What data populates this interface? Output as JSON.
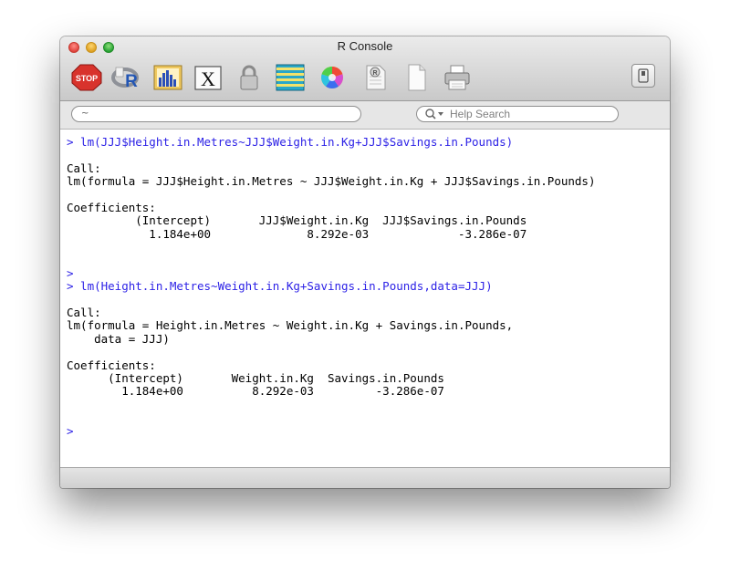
{
  "window": {
    "title": "R Console"
  },
  "toolbar": {
    "buttons": [
      {
        "name": "stop-button",
        "icon": "stop-sign-icon",
        "text": "STOP"
      },
      {
        "name": "source-script-button",
        "icon": "r-logo-icon"
      },
      {
        "name": "quartz-button",
        "icon": "bar-chart-icon"
      },
      {
        "name": "x11-button",
        "icon": "x-window-icon",
        "text": "X"
      },
      {
        "name": "authentication-button",
        "icon": "padlock-icon"
      },
      {
        "name": "show-history-button",
        "icon": "striped-list-icon"
      },
      {
        "name": "set-colors-button",
        "icon": "color-wheel-icon"
      },
      {
        "name": "open-document-button",
        "icon": "document-search-icon"
      },
      {
        "name": "new-document-button",
        "icon": "blank-document-icon"
      },
      {
        "name": "print-button",
        "icon": "printer-icon"
      }
    ],
    "toggle_icon": "toolbar-toggle-icon"
  },
  "search": {
    "working_dir": "~",
    "help_placeholder": "Help Search"
  },
  "console": {
    "lines": [
      {
        "kind": "cmd",
        "text": "> lm(JJJ$Height.in.Metres~JJJ$Weight.in.Kg+JJJ$Savings.in.Pounds)"
      },
      {
        "kind": "out",
        "text": ""
      },
      {
        "kind": "out",
        "text": "Call:"
      },
      {
        "kind": "out",
        "text": "lm(formula = JJJ$Height.in.Metres ~ JJJ$Weight.in.Kg + JJJ$Savings.in.Pounds)"
      },
      {
        "kind": "out",
        "text": ""
      },
      {
        "kind": "out",
        "text": "Coefficients:"
      },
      {
        "kind": "out",
        "text": "          (Intercept)       JJJ$Weight.in.Kg  JJJ$Savings.in.Pounds"
      },
      {
        "kind": "out",
        "text": "            1.184e+00              8.292e-03             -3.286e-07"
      },
      {
        "kind": "out",
        "text": ""
      },
      {
        "kind": "out",
        "text": ""
      },
      {
        "kind": "cmd",
        "text": ">"
      },
      {
        "kind": "cmd",
        "text": "> lm(Height.in.Metres~Weight.in.Kg+Savings.in.Pounds,data=JJJ)"
      },
      {
        "kind": "out",
        "text": ""
      },
      {
        "kind": "out",
        "text": "Call:"
      },
      {
        "kind": "out",
        "text": "lm(formula = Height.in.Metres ~ Weight.in.Kg + Savings.in.Pounds,"
      },
      {
        "kind": "out",
        "text": "    data = JJJ)"
      },
      {
        "kind": "out",
        "text": ""
      },
      {
        "kind": "out",
        "text": "Coefficients:"
      },
      {
        "kind": "out",
        "text": "      (Intercept)       Weight.in.Kg  Savings.in.Pounds"
      },
      {
        "kind": "out",
        "text": "        1.184e+00          8.292e-03         -3.286e-07"
      },
      {
        "kind": "out",
        "text": ""
      },
      {
        "kind": "out",
        "text": ""
      },
      {
        "kind": "cmd",
        "text": ">"
      }
    ]
  },
  "colors": {
    "command_text": "#2d22e6",
    "output_text": "#000000"
  }
}
